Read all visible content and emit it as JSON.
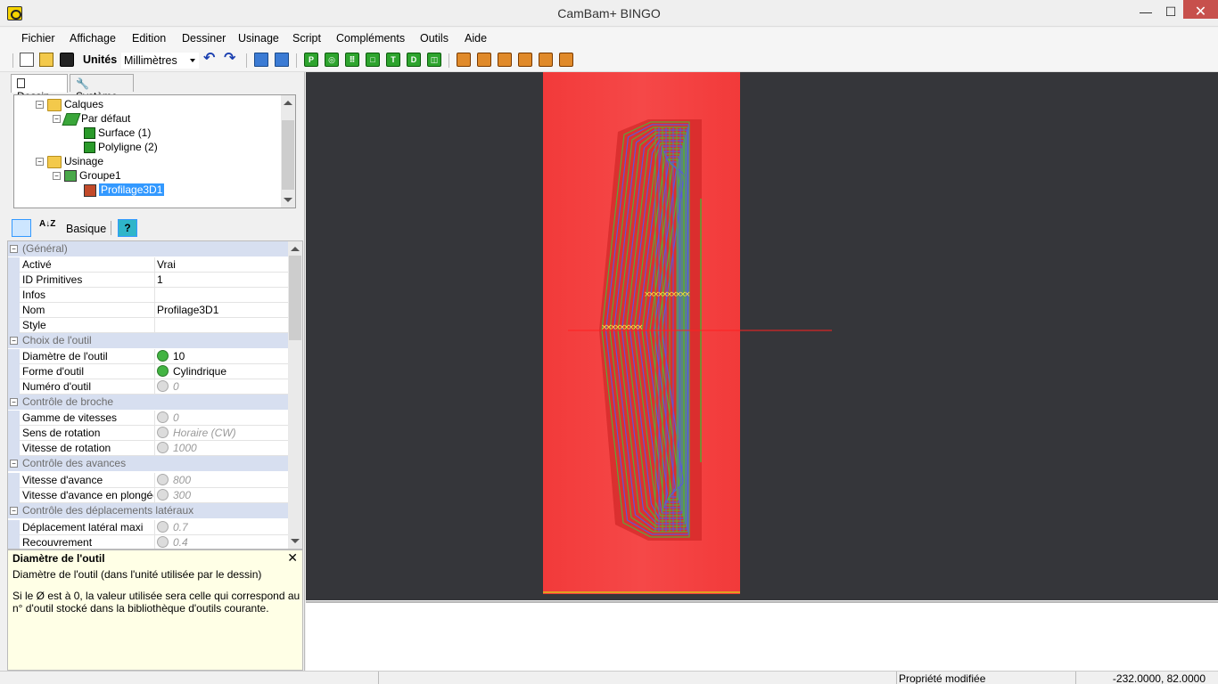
{
  "window": {
    "title": "CamBam+  BINGO",
    "min_glyph": "—",
    "max_glyph": "☐",
    "close_glyph": "✕"
  },
  "menu": [
    "Fichier",
    "Affichage",
    "Edition",
    "Dessiner",
    "Usinage",
    "Script",
    "Compléments",
    "Outils",
    "Aide"
  ],
  "toolbar": {
    "units_label": "Unités",
    "units_value": "Millimètres",
    "green_buttons": [
      "P",
      "◎",
      "⠿",
      "□",
      "T",
      "D",
      "◫"
    ]
  },
  "tabs": {
    "dessin": "Dessin",
    "systeme": "Système"
  },
  "tree": {
    "calques": "Calques",
    "par_defaut": "Par défaut",
    "surface": "Surface (1)",
    "polyligne": "Polyligne (2)",
    "usinage": "Usinage",
    "groupe1": "Groupe1",
    "profilage": "Profilage3D1"
  },
  "properties_toolbar": {
    "basique": "Basique",
    "help": "?",
    "az": "A↓Z"
  },
  "properties": {
    "general": "(Général)",
    "active_name": "Activé",
    "active_val": "Vrai",
    "idprim_name": "ID Primitives",
    "idprim_val": "1",
    "infos_name": "Infos",
    "infos_val": "",
    "nom_name": "Nom",
    "nom_val": "Profilage3D1",
    "style_name": "Style",
    "style_val": "",
    "choix_outil": "Choix de l'outil",
    "diam_name": "Diamètre de l'outil",
    "diam_val": "10",
    "forme_name": "Forme d'outil",
    "forme_val": "Cylindrique",
    "numero_name": "Numéro d'outil",
    "numero_val": "0",
    "broche": "Contrôle de broche",
    "gamme_name": "Gamme de vitesses",
    "gamme_val": "0",
    "sens_name": "Sens de rotation",
    "sens_val": "Horaire (CW)",
    "vrot_name": "Vitesse de rotation",
    "vrot_val": "1000",
    "avances": "Contrôle des avances",
    "vav_name": "Vitesse d'avance",
    "vav_val": "800",
    "vplong_name": "Vitesse d'avance en plongée",
    "vplong_val": "300",
    "lateraux": "Contrôle des déplacements latéraux",
    "dlat_name": "Déplacement latéral maxi",
    "dlat_val": "0.7",
    "recouv_name": "Recouvrement",
    "recouv_val": "0.4"
  },
  "help": {
    "title": "Diamètre de l'outil",
    "line1": "Diamètre de l'outil (dans l'unité utilisée par le dessin)",
    "line2": "Si le Ø est à 0, la valeur utilisée sera celle qui correspond au n° d'outil stocké dans la bibliothèque d'outils courante.",
    "close": "✕"
  },
  "status": {
    "message": "Propriété modifiée",
    "coords": "-232.0000, 82.0000"
  },
  "colors": {
    "viewport_bg": "#35363a",
    "stock": "#f03c3c",
    "toolpath_green": "#5aa83a",
    "toolpath_blue": "#5a5ad8",
    "axis_red": "#ff2020",
    "selection": "#3399ff"
  }
}
